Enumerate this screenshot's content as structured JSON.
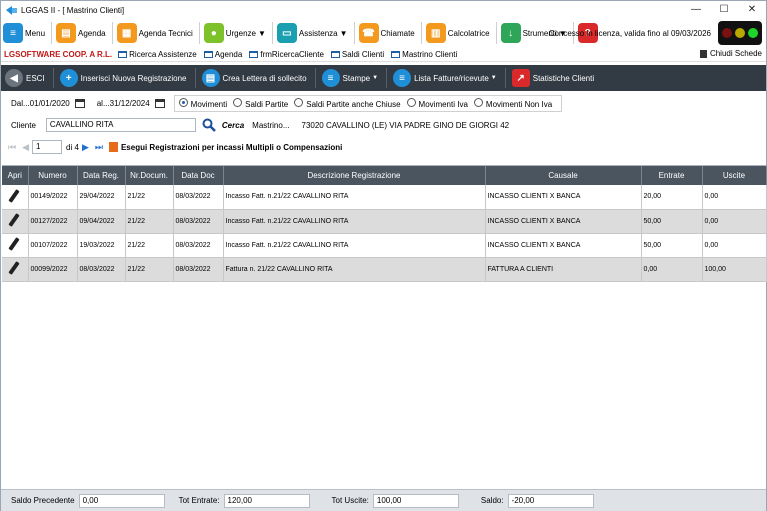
{
  "window": {
    "title": "LGGAS II - [ Mastrino Clienti]",
    "minimize": "—",
    "maximize": "☐",
    "close": "✕"
  },
  "toolbar": {
    "items": [
      {
        "label": "Menu",
        "icon": "menu-icon"
      },
      {
        "label": "Agenda",
        "icon": "agenda-icon"
      },
      {
        "label": "Agenda Tecnici",
        "icon": "calendar-icon"
      },
      {
        "label": "Urgenze",
        "icon": "lightbulb-icon"
      },
      {
        "label": "Assistenza",
        "icon": "monitor-icon"
      },
      {
        "label": "Chiamate",
        "icon": "phone-icon"
      },
      {
        "label": "Calcolatrice",
        "icon": "calculator-icon"
      },
      {
        "label": "Strumenti",
        "icon": "download-icon"
      },
      {
        "label": "",
        "icon": "help-icon"
      }
    ],
    "license": "Concesso in licenza, valida fino al 09/03/2026",
    "lights": [
      "#7a1010",
      "#b8a800",
      "#1fd428"
    ]
  },
  "links": {
    "brand": "LGSOFTWARE COOP. A R.L.",
    "items": [
      "Ricerca Assistenze",
      "Agenda",
      "frmRicercaCliente",
      "Saldi Clienti",
      "Mastrino Clienti"
    ],
    "close_tabs": "Chiudi Schede"
  },
  "actions": {
    "esci": "ESCI",
    "nuova": "Inserisci Nuova Registrazione",
    "lettera": "Crea Lettera di sollecito",
    "stampe": "Stampe",
    "lista": "Lista Fatture/ricevute",
    "statistiche": "Statistiche Clienti"
  },
  "filters": {
    "dal_label": "Dal...",
    "dal_value": "01/01/2020",
    "al_label": "al...",
    "al_value": "31/12/2024",
    "options": [
      "Movimenti",
      "Saldi Partite",
      "Saldi Partite anche Chiuse",
      "Movimenti Iva",
      "Movimenti Non Iva"
    ],
    "selected": "Movimenti",
    "cliente_label": "Cliente",
    "cliente_value": "CAVALLINO RITA",
    "cerca": "Cerca",
    "mastrino_label": "Mastrino...",
    "address": "73020 CAVALLINO (LE) VIA PADRE GINO DE GIORGI 42"
  },
  "pager": {
    "current": "1",
    "total": "di 4",
    "execute": "Esegui Registrazioni per incassi Multipli o Compensazioni"
  },
  "table": {
    "headers": [
      "Apri",
      "Numero",
      "Data Reg.",
      "Nr.Docum.",
      "Data Doc",
      "Descrizione Registrazione",
      "Causale",
      "Entrate",
      "Uscite"
    ],
    "rows": [
      [
        "00149/2022",
        "29/04/2022",
        "21/22",
        "08/03/2022",
        "Incasso Fatt. n.21/22 CAVALLINO RITA",
        "INCASSO CLIENTI X BANCA",
        "20,00",
        "0,00"
      ],
      [
        "00127/2022",
        "09/04/2022",
        "21/22",
        "08/03/2022",
        "Incasso Fatt. n.21/22 CAVALLINO RITA",
        "INCASSO CLIENTI X BANCA",
        "50,00",
        "0,00"
      ],
      [
        "00107/2022",
        "19/03/2022",
        "21/22",
        "08/03/2022",
        "Incasso Fatt. n.21/22 CAVALLINO RITA",
        "INCASSO CLIENTI X BANCA",
        "50,00",
        "0,00"
      ],
      [
        "00099/2022",
        "08/03/2022",
        "21/22",
        "08/03/2022",
        "Fattura n. 21/22 CAVALLINO RITA",
        "FATTURA A CLIENTI",
        "0,00",
        "100,00"
      ]
    ]
  },
  "totals": {
    "saldo_prec_label": "Saldo Precedente",
    "saldo_prec": "0,00",
    "tot_entrate_label": "Tot Entrate:",
    "tot_entrate": "120,00",
    "tot_uscite_label": "Tot Uscite:",
    "tot_uscite": "100,00",
    "saldo_label": "Saldo:",
    "saldo": "-20,00"
  }
}
